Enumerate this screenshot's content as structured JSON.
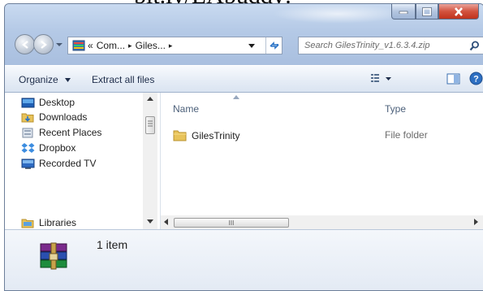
{
  "document_header_text": "bit.ly/LAbuddy:",
  "window": {
    "title_buttons": [
      "minimize",
      "maximize",
      "close"
    ]
  },
  "address": {
    "prefix": "«",
    "segments": [
      "Com...",
      "Giles..."
    ],
    "separator": "▸"
  },
  "search": {
    "placeholder": "Search GilesTrinity_v1.6.3.4.zip"
  },
  "toolbar": {
    "organize_label": "Organize",
    "extract_label": "Extract all files"
  },
  "sidebar": {
    "items": [
      {
        "label": "Desktop",
        "icon": "desktop-icon"
      },
      {
        "label": "Downloads",
        "icon": "downloads-folder-icon"
      },
      {
        "label": "Recent Places",
        "icon": "recent-places-icon"
      },
      {
        "label": "Dropbox",
        "icon": "dropbox-icon"
      },
      {
        "label": "Recorded TV",
        "icon": "recorded-tv-icon"
      },
      {
        "label": "Libraries",
        "icon": "libraries-icon"
      }
    ]
  },
  "columns": {
    "name": "Name",
    "type": "Type"
  },
  "files": [
    {
      "name": "GilesTrinity",
      "type": "File folder",
      "icon": "folder-icon"
    }
  ],
  "hscroll_grip": "III",
  "details": {
    "count": "1 item",
    "icon": "winrar-archive-icon"
  },
  "colors": {
    "chrome": "#b9cde6",
    "close_button": "#c0321c",
    "folder": "#e8c35a"
  }
}
